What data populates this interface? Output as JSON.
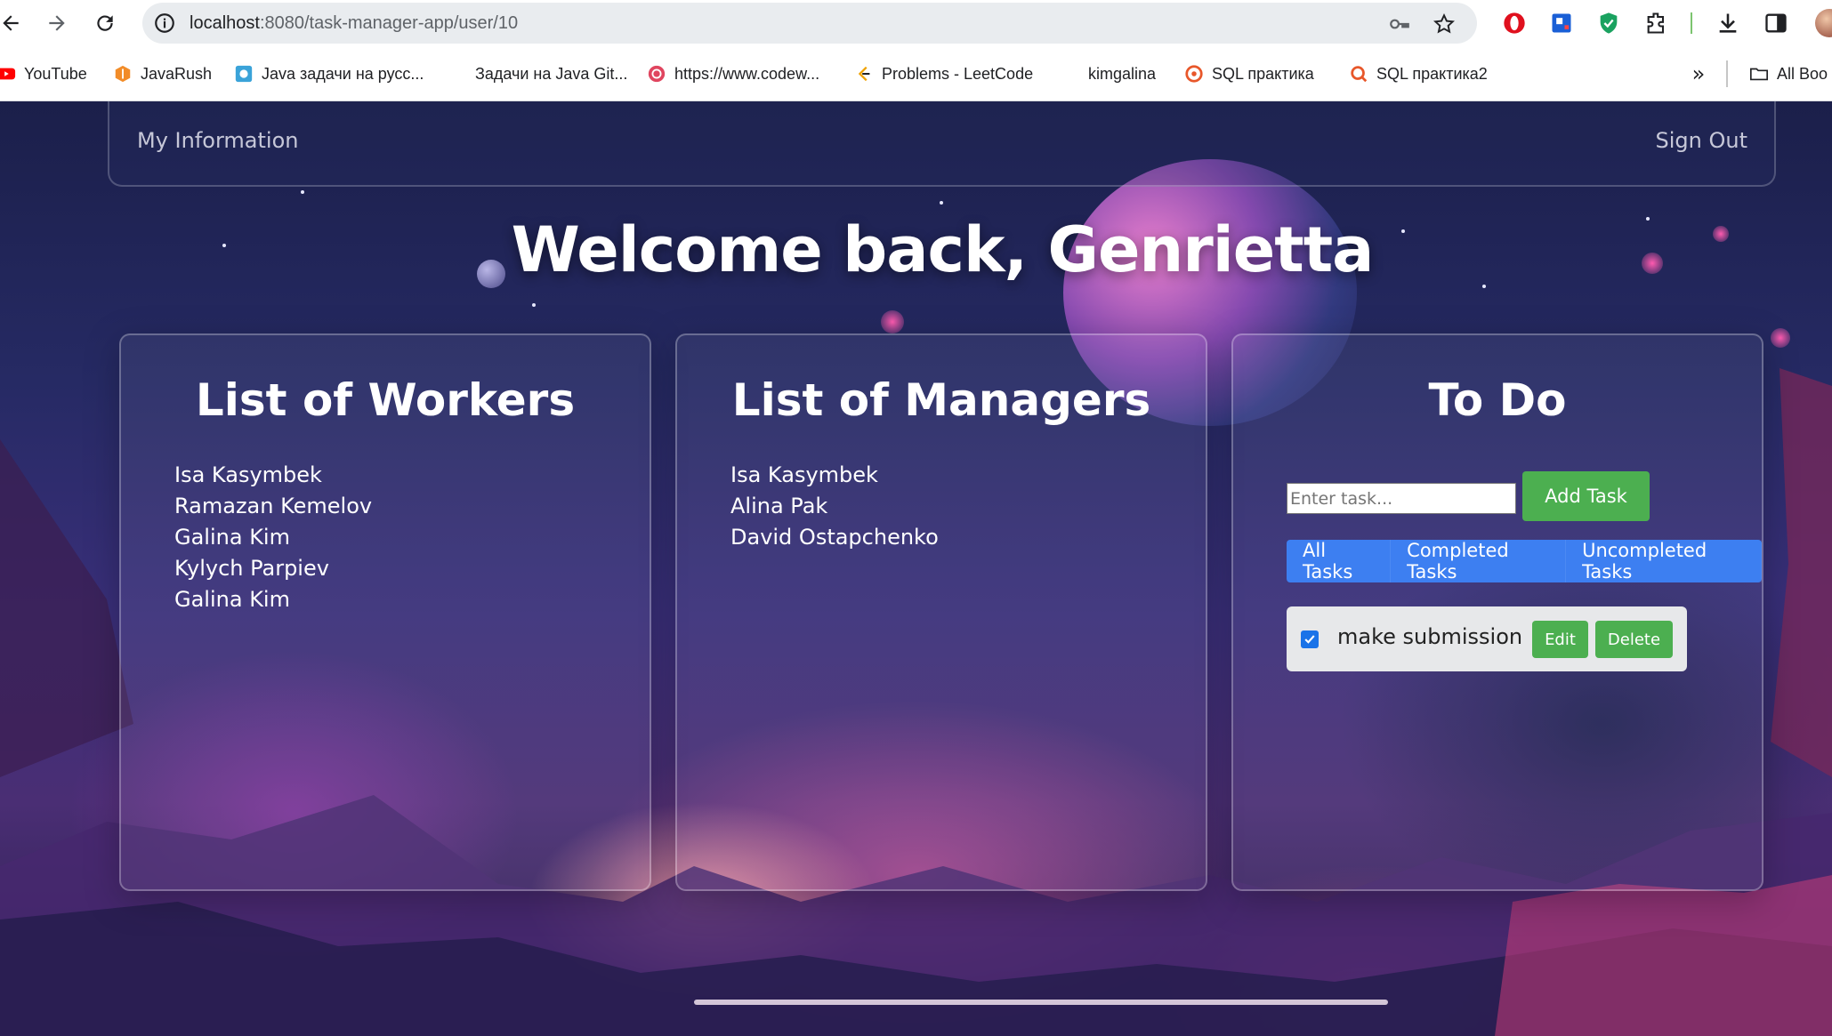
{
  "browser": {
    "url_host": "localhost",
    "url_path": ":8080/task-manager-app/user/10",
    "bookmarks": [
      {
        "label": "YouTube",
        "icon": "youtube-icon"
      },
      {
        "label": "JavaRush",
        "icon": "javarush-icon"
      },
      {
        "label": "Java задачи на русс...",
        "icon": "puzzle-icon"
      },
      {
        "label": "Задачи на Java Git...",
        "icon": "none"
      },
      {
        "label": "https://www.codew...",
        "icon": "codewars-icon"
      },
      {
        "label": "Problems - LeetCode",
        "icon": "leetcode-icon"
      },
      {
        "label": "kimgalina",
        "icon": "none"
      },
      {
        "label": "SQL  практика",
        "icon": "sql-icon"
      },
      {
        "label": "SQL практика2",
        "icon": "sql-icon"
      }
    ],
    "bookmarks_more": "»",
    "all_bookmarks": "All Boo"
  },
  "nav": {
    "left_link": "My Information",
    "right_link": "Sign Out"
  },
  "welcome": "Welcome back, Genrietta",
  "workers": {
    "title": "List of Workers",
    "items": [
      "Isa Kasymbek",
      "Ramazan Kemelov",
      "Galina Kim",
      "Kylych Parpiev",
      "Galina Kim"
    ]
  },
  "managers": {
    "title": "List of Managers",
    "items": [
      "Isa Kasymbek",
      "Alina Pak",
      "David Ostapchenko"
    ]
  },
  "todo": {
    "title": "To Do",
    "input_placeholder": "Enter task...",
    "add_label": "Add Task",
    "filters": [
      "All Tasks",
      "Completed Tasks",
      "Uncompleted Tasks"
    ],
    "tasks": [
      {
        "text": "make submission",
        "checked": true,
        "edit_label": "Edit",
        "delete_label": "Delete"
      }
    ]
  },
  "colors": {
    "accent_green": "#4caf50",
    "filter_blue": "#3d7ff1",
    "checkbox_blue": "#1a73e8"
  }
}
